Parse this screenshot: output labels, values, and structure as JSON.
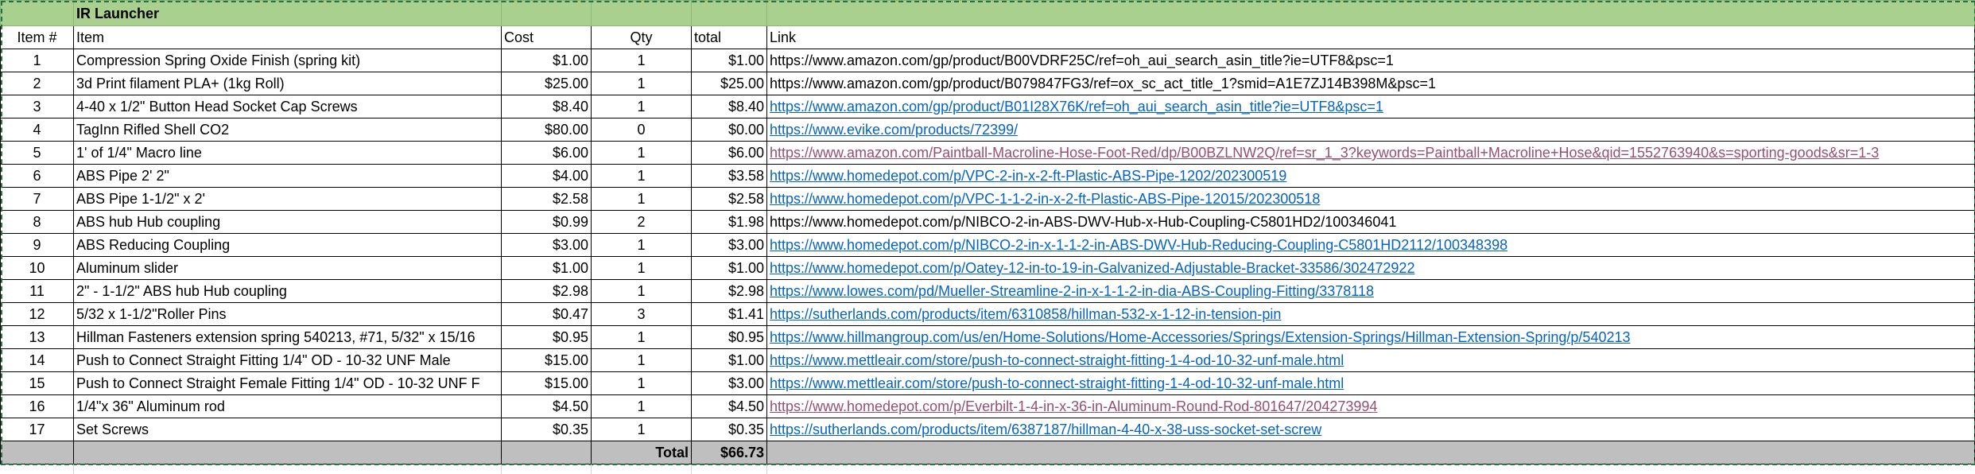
{
  "title": "IR Launcher",
  "headers": {
    "num": "Item #",
    "item": "Item",
    "cost": "Cost",
    "qty": "Qty",
    "total": "total",
    "link": "Link"
  },
  "colors": {
    "header_bg": "#a9d08e",
    "total_bg": "#bfbfbf",
    "link": "#0563c1",
    "visited_link": "#954f72",
    "selection": "#217346"
  },
  "rows": [
    {
      "num": "1",
      "item": "Compression Spring Oxide Finish (spring kit)",
      "cost": "$1.00",
      "qty": "1",
      "total": "$1.00",
      "link": "https://www.amazon.com/gp/product/B00VDRF25C/ref=oh_aui_search_asin_title?ie=UTF8&psc=1",
      "style": "plain"
    },
    {
      "num": "2",
      "item": "3d Print filament PLA+ (1kg Roll)",
      "cost": "$25.00",
      "qty": "1",
      "total": "$25.00",
      "link": "https://www.amazon.com/gp/product/B079847FG3/ref=ox_sc_act_title_1?smid=A1E7ZJ14B398M&psc=1",
      "style": "plain"
    },
    {
      "num": "3",
      "item": "4-40 x 1/2\" Button Head Socket Cap Screws",
      "cost": "$8.40",
      "qty": "1",
      "total": "$8.40",
      "link": "https://www.amazon.com/gp/product/B01I28X76K/ref=oh_aui_search_asin_title?ie=UTF8&psc=1",
      "style": "link"
    },
    {
      "num": "4",
      "item": "TagInn Rifled Shell CO2",
      "cost": "$80.00",
      "qty": "0",
      "total": "$0.00",
      "link": "https://www.evike.com/products/72399/",
      "style": "link"
    },
    {
      "num": "5",
      "item": "1' of 1/4\" Macro line",
      "cost": "$6.00",
      "qty": "1",
      "total": "$6.00",
      "link": "https://www.amazon.com/Paintball-Macroline-Hose-Foot-Red/dp/B00BZLNW2Q/ref=sr_1_3?keywords=Paintball+Macroline+Hose&qid=1552763940&s=sporting-goods&sr=1-3",
      "style": "visited"
    },
    {
      "num": "6",
      "item": "ABS Pipe 2' 2\"",
      "cost": "$4.00",
      "qty": "1",
      "total": "$3.58",
      "link": "https://www.homedepot.com/p/VPC-2-in-x-2-ft-Plastic-ABS-Pipe-1202/202300519",
      "style": "link"
    },
    {
      "num": "7",
      "item": "ABS Pipe 1-1/2\" x 2'",
      "cost": "$2.58",
      "qty": "1",
      "total": "$2.58",
      "link": "https://www.homedepot.com/p/VPC-1-1-2-in-x-2-ft-Plastic-ABS-Pipe-12015/202300518",
      "style": "link"
    },
    {
      "num": "8",
      "item": "ABS hub Hub coupling",
      "cost": "$0.99",
      "qty": "2",
      "total": "$1.98",
      "link": "https://www.homedepot.com/p/NIBCO-2-in-ABS-DWV-Hub-x-Hub-Coupling-C5801HD2/100346041",
      "style": "plain"
    },
    {
      "num": "9",
      "item": "ABS Reducing Coupling",
      "cost": "$3.00",
      "qty": "1",
      "total": "$3.00",
      "link": "https://www.homedepot.com/p/NIBCO-2-in-x-1-1-2-in-ABS-DWV-Hub-Reducing-Coupling-C5801HD2112/100348398",
      "style": "link"
    },
    {
      "num": "10",
      "item": "Aluminum slider",
      "cost": "$1.00",
      "qty": "1",
      "total": "$1.00",
      "link": "https://www.homedepot.com/p/Oatey-12-in-to-19-in-Galvanized-Adjustable-Bracket-33586/302472922",
      "style": "link"
    },
    {
      "num": "11",
      "item": "2\" - 1-1/2\" ABS hub Hub coupling",
      "cost": "$2.98",
      "qty": "1",
      "total": "$2.98",
      "link": "https://www.lowes.com/pd/Mueller-Streamline-2-in-x-1-1-2-in-dia-ABS-Coupling-Fitting/3378118",
      "style": "link"
    },
    {
      "num": "12",
      "item": "5/32 x 1-1/2\"Roller Pins",
      "cost": "$0.47",
      "qty": "3",
      "total": "$1.41",
      "link": "https://sutherlands.com/products/item/6310858/hillman-532-x-1-12-in-tension-pin",
      "style": "link"
    },
    {
      "num": "13",
      "item": "Hillman Fasteners extension spring 540213, #71, 5/32\" x 15/16",
      "cost": "$0.95",
      "qty": "1",
      "total": "$0.95",
      "link": "https://www.hillmangroup.com/us/en/Home-Solutions/Home-Accessories/Springs/Extension-Springs/Hillman-Extension-Spring/p/540213",
      "style": "link"
    },
    {
      "num": "14",
      "item": "Push to Connect Straight Fitting 1/4\" OD - 10-32 UNF Male",
      "cost": "$15.00",
      "qty": "1",
      "total": "$1.00",
      "link": "https://www.mettleair.com/store/push-to-connect-straight-fitting-1-4-od-10-32-unf-male.html",
      "style": "link"
    },
    {
      "num": "15",
      "item": "Push to Connect Straight Female Fitting 1/4\" OD - 10-32 UNF F",
      "cost": "$15.00",
      "qty": "1",
      "total": "$3.00",
      "link": "https://www.mettleair.com/store/push-to-connect-straight-fitting-1-4-od-10-32-unf-male.html",
      "style": "link"
    },
    {
      "num": "16",
      "item": "1/4\"x 36\" Aluminum rod",
      "cost": "$4.50",
      "qty": "1",
      "total": "$4.50",
      "link": "https://www.homedepot.com/p/Everbilt-1-4-in-x-36-in-Aluminum-Round-Rod-801647/204273994",
      "style": "visited"
    },
    {
      "num": "17",
      "item": "Set Screws",
      "cost": "$0.35",
      "qty": "1",
      "total": "$0.35",
      "link": "https://sutherlands.com/products/item/6387187/hillman-4-40-x-38-uss-socket-set-screw",
      "style": "link"
    }
  ],
  "footer": {
    "label": "Total",
    "value": "$66.73"
  }
}
